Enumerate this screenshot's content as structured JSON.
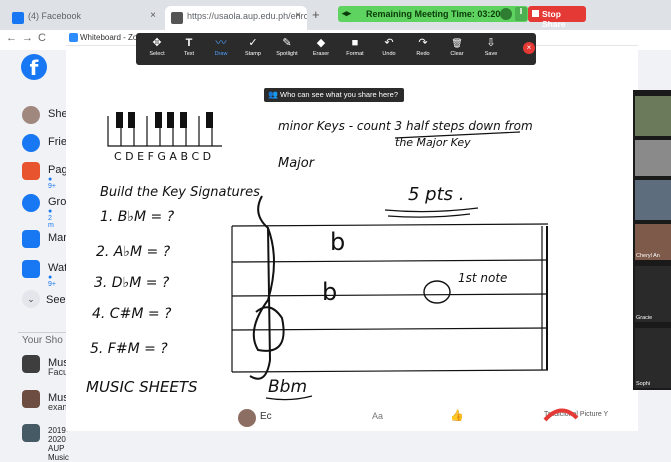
{
  "browser": {
    "tabs": [
      {
        "label": "(4) Facebook",
        "close": "×",
        "icon_color": "#1877f2"
      },
      {
        "label": "https://usaola.aup.edu.ph/enroll",
        "close": "×",
        "icon_color": "#555555"
      }
    ],
    "new_tab": "+",
    "nav": {
      "back": "←",
      "forward": "→",
      "reload": "C"
    }
  },
  "meeting": {
    "remaining_label": "Remaining Meeting Time: 03:20",
    "pause_glyph": "‖",
    "stop_share": "Stop Share",
    "bar_color": "#5fd35f",
    "stop_color": "#e53935"
  },
  "facebook": {
    "logo": "f",
    "items": [
      {
        "label": "Sher",
        "icon": "avatar-icon",
        "color": "#a1887f",
        "sub": ""
      },
      {
        "label": "Frien",
        "icon": "friends-icon",
        "color": "#1877f2",
        "sub": ""
      },
      {
        "label": "Pag",
        "icon": "pages-flag-icon",
        "color": "#e8542d",
        "sub": "● 9+"
      },
      {
        "label": "Grou",
        "icon": "groups-icon",
        "color": "#1877f2",
        "sub": "● 2 m"
      },
      {
        "label": "Mar",
        "icon": "marketplace-icon",
        "color": "#1877f2",
        "sub": ""
      },
      {
        "label": "Wat",
        "icon": "watch-icon",
        "color": "#1877f2",
        "sub": "● 9+"
      }
    ],
    "see_more": "See",
    "see_more_glyph": "⌄",
    "shortcuts_heading": "Your Sho",
    "shortcuts": [
      {
        "label": "Mus",
        "sub": "Facu"
      },
      {
        "label": "Mus",
        "sub": "exam"
      },
      {
        "label": "2019-2020 AUP Music",
        "sub": ""
      }
    ]
  },
  "zoom": {
    "title": "Whiteboard - Zoom",
    "tools": [
      {
        "label": "Select",
        "glyph": "✥",
        "icon": "select-icon"
      },
      {
        "label": "Text",
        "glyph": "T",
        "icon": "text-icon"
      },
      {
        "label": "Draw",
        "glyph": "〰",
        "icon": "draw-icon",
        "active": true
      },
      {
        "label": "Stamp",
        "glyph": "✓",
        "icon": "stamp-icon"
      },
      {
        "label": "Spotlight",
        "glyph": "✎",
        "icon": "spotlight-icon"
      },
      {
        "label": "Eraser",
        "glyph": "◆",
        "icon": "eraser-icon"
      },
      {
        "label": "Format",
        "glyph": "■",
        "icon": "format-icon"
      },
      {
        "label": "Undo",
        "glyph": "↶",
        "icon": "undo-icon"
      },
      {
        "label": "Redo",
        "glyph": "↷",
        "icon": "redo-icon"
      },
      {
        "label": "Clear",
        "glyph": "🗑",
        "icon": "clear-icon"
      },
      {
        "label": "Save",
        "glyph": "⇩",
        "icon": "save-icon"
      }
    ],
    "close_glyph": "×",
    "who_can_see": "Who can see what you share here?",
    "accent": "#4ea1ff"
  },
  "whiteboard": {
    "keyboard_letters": "C D E F G A B C D",
    "minor_keys_line1": "minor Keys - count 3 half steps down from",
    "minor_keys_line2": "the Major Key",
    "major": "Major",
    "build": "Build the Key Signatures",
    "points": "5 pts .",
    "exercises": [
      "1. B♭M = ?",
      "2. A♭M = ?",
      "3. D♭M = ?",
      "4. C#M = ?",
      "5. F#M = ?"
    ],
    "flat_glyph": "b",
    "first_note": "1st note",
    "music_sheets": "MUSIC SHEETS",
    "bbm": "Bbm"
  },
  "participants": [
    {
      "name": ""
    },
    {
      "name": ""
    },
    {
      "name": ""
    },
    {
      "name": "Cheryl An"
    },
    {
      "name": "Gracie"
    },
    {
      "name": "Sophi"
    }
  ],
  "bottom": {
    "name": "Ec",
    "aa": "Aa",
    "site": "Tradicional Picture Y"
  }
}
